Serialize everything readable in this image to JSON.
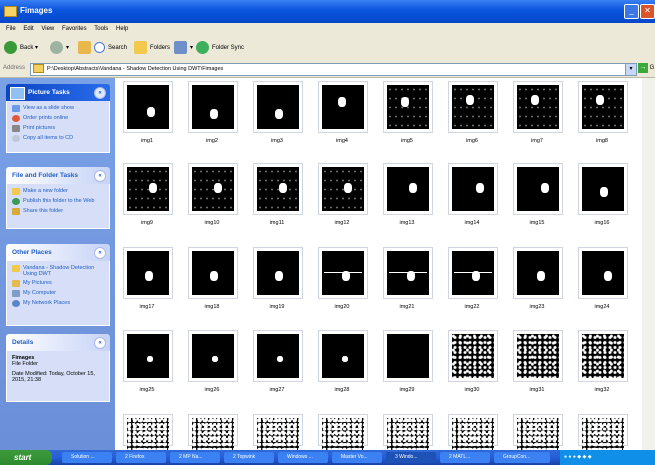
{
  "window": {
    "title": "Fimages"
  },
  "menu": [
    "File",
    "Edit",
    "View",
    "Favorites",
    "Tools",
    "Help"
  ],
  "toolbar": {
    "back": "Back",
    "search": "Search",
    "folders": "Folders",
    "folder_sync": "Folder Sync"
  },
  "address": {
    "label": "Address",
    "path": "P:\\Desktop\\Abstracts\\Vandana - Shadow Detection Using DWT\\Fimages"
  },
  "picture_tasks": {
    "title": "Picture Tasks",
    "items": [
      "View as a slide show",
      "Order prints online",
      "Print pictures",
      "Copy all items to CD"
    ]
  },
  "file_tasks": {
    "title": "File and Folder Tasks",
    "items": [
      "Make a new folder",
      "Publish this folder to the Web",
      "Share this folder"
    ]
  },
  "other_places": {
    "title": "Other Places",
    "items": [
      "Vandana - Shadow Detection Using DWT",
      "My Pictures",
      "My Computer",
      "My Network Places"
    ]
  },
  "details": {
    "title": "Details",
    "name": "Fimages",
    "type": "File Folder",
    "modified": "Date Modified: Today, October 15, 2015, 21:38"
  },
  "files": [
    "img1",
    "img2",
    "img3",
    "img4",
    "img5",
    "img6",
    "img7",
    "img8",
    "img9",
    "img10",
    "img11",
    "img12",
    "img13",
    "img14",
    "img15",
    "img16",
    "img17",
    "img18",
    "img19",
    "img20",
    "img21",
    "img22",
    "img23",
    "img24",
    "img25",
    "img26",
    "img27",
    "img28",
    "img29",
    "img30",
    "img31",
    "img32"
  ],
  "taskbar": {
    "start": "start",
    "tasks": [
      "Solution ...",
      "2 Firefox",
      "2 MP Na...",
      "2 Topwink",
      "Windows ...",
      "Master Vo...",
      "3 Windo...",
      "2 MATL...",
      "GroupCon..."
    ]
  }
}
